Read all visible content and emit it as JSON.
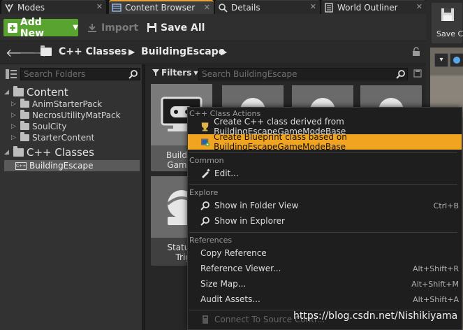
{
  "tabs": [
    {
      "label": "Modes",
      "icon": "modes-icon"
    },
    {
      "label": "Content Browser",
      "icon": "content-browser-icon"
    },
    {
      "label": "Details",
      "icon": "details-icon"
    },
    {
      "label": "World Outliner",
      "icon": "world-outliner-icon"
    }
  ],
  "toolbar": {
    "add_new": "Add New",
    "import": "Import",
    "save_all": "Save All",
    "save_current_partial": "Save C"
  },
  "breadcrumb": {
    "items": [
      "C++ Classes",
      "BuildingEscape"
    ]
  },
  "sources": {
    "search_placeholder": "Search Folders",
    "tree": [
      {
        "label": "Content",
        "level": 0
      },
      {
        "label": "AnimStarterPack",
        "level": 1
      },
      {
        "label": "NecrosUtilityMatPack",
        "level": 1
      },
      {
        "label": "SoulCity",
        "level": 1
      },
      {
        "label": "StarterContent",
        "level": 1
      },
      {
        "label": "C++ Classes",
        "level": 0
      },
      {
        "label": "BuildingEscape",
        "level": 1,
        "selected": true
      }
    ]
  },
  "assets": {
    "filters_label": "Filters",
    "search_placeholder": "Search BuildingEscape",
    "tiles": [
      {
        "name_line1": "BuildingE",
        "name_line2": "GameMo"
      },
      {
        "name_line1": "StatueLo",
        "name_line2": "Trigg"
      }
    ]
  },
  "context_menu": {
    "sections": [
      {
        "title": "C++ Class Actions",
        "items": [
          {
            "label": "Create C++ class derived from BuildingEscapeGameModeBase",
            "icon": "cpp-class-icon",
            "shortcut": ""
          },
          {
            "label": "Create Blueprint class based on BuildingEscapeGameModeBase",
            "icon": "blueprint-class-icon",
            "shortcut": "",
            "highlighted": true
          }
        ]
      },
      {
        "title": "Common",
        "items": [
          {
            "label": "Edit...",
            "icon": "edit-icon",
            "shortcut": ""
          }
        ]
      },
      {
        "title": "Explore",
        "items": [
          {
            "label": "Show in Folder View",
            "icon": "magnifier-icon",
            "shortcut": "Ctrl+B"
          },
          {
            "label": "Show in Explorer",
            "icon": "magnifier-icon",
            "shortcut": ""
          }
        ]
      },
      {
        "title": "References",
        "items": [
          {
            "label": "Copy Reference",
            "shortcut": ""
          },
          {
            "label": "Reference Viewer...",
            "shortcut": "Alt+Shift+R"
          },
          {
            "label": "Size Map...",
            "shortcut": "Alt+Shift+M"
          },
          {
            "label": "Audit Assets...",
            "shortcut": "Alt+Shift+A"
          },
          {
            "label": "Connect To Source Contr...",
            "icon": "source-control-icon",
            "shortcut": "",
            "disabled": true
          }
        ]
      }
    ]
  },
  "watermark": "https://blog.csdn.net/Nishikiyama",
  "colors": {
    "accent_orange": "#f0a41f",
    "add_new_green": "#59a431",
    "background": "#1a1a1a"
  }
}
